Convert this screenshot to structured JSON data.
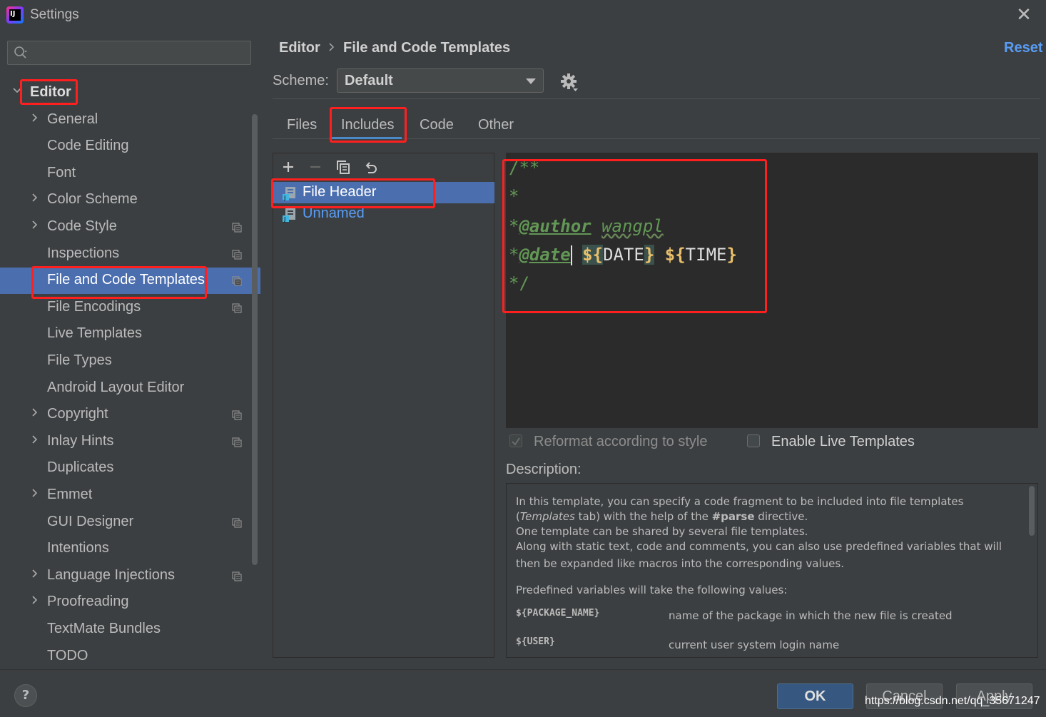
{
  "window": {
    "title": "Settings"
  },
  "search": {
    "placeholder": ""
  },
  "sidebar": {
    "root": "Editor",
    "items": [
      {
        "label": "General",
        "expandable": true,
        "config": false
      },
      {
        "label": "Code Editing",
        "expandable": false,
        "config": false
      },
      {
        "label": "Font",
        "expandable": false,
        "config": false
      },
      {
        "label": "Color Scheme",
        "expandable": true,
        "config": false
      },
      {
        "label": "Code Style",
        "expandable": true,
        "config": true
      },
      {
        "label": "Inspections",
        "expandable": false,
        "config": true
      },
      {
        "label": "File and Code Templates",
        "expandable": false,
        "config": true,
        "selected": true
      },
      {
        "label": "File Encodings",
        "expandable": false,
        "config": true
      },
      {
        "label": "Live Templates",
        "expandable": false,
        "config": false
      },
      {
        "label": "File Types",
        "expandable": false,
        "config": false
      },
      {
        "label": "Android Layout Editor",
        "expandable": false,
        "config": false
      },
      {
        "label": "Copyright",
        "expandable": true,
        "config": true
      },
      {
        "label": "Inlay Hints",
        "expandable": true,
        "config": true
      },
      {
        "label": "Duplicates",
        "expandable": false,
        "config": false
      },
      {
        "label": "Emmet",
        "expandable": true,
        "config": false
      },
      {
        "label": "GUI Designer",
        "expandable": false,
        "config": true
      },
      {
        "label": "Intentions",
        "expandable": false,
        "config": false
      },
      {
        "label": "Language Injections",
        "expandable": true,
        "config": true
      },
      {
        "label": "Proofreading",
        "expandable": true,
        "config": false
      },
      {
        "label": "TextMate Bundles",
        "expandable": false,
        "config": false
      },
      {
        "label": "TODO",
        "expandable": false,
        "config": false
      }
    ]
  },
  "breadcrumb": {
    "parent": "Editor",
    "current": "File and Code Templates"
  },
  "reset_label": "Reset",
  "scheme": {
    "label": "Scheme:",
    "value": "Default"
  },
  "tabs": [
    "Files",
    "Includes",
    "Code",
    "Other"
  ],
  "active_tab": "Includes",
  "templates": [
    {
      "name": "File Header",
      "selected": true
    },
    {
      "name": "Unnamed",
      "selected": false
    }
  ],
  "code": {
    "line1": "/**",
    "line2": "*",
    "line3_star": "*",
    "author_tag": "@author",
    "author_value": "wangpl",
    "line4_star": "*",
    "date_tag": "@date",
    "date_open": "${",
    "date_var": "DATE",
    "date_close": "}",
    "time_open": "${",
    "time_var": "TIME",
    "time_close": "}",
    "line5": "*/"
  },
  "options": {
    "reformat": {
      "label": "Reformat according to style",
      "checked": true,
      "disabled": true
    },
    "live_templates": {
      "label": "Enable Live Templates",
      "checked": false
    }
  },
  "description": {
    "label": "Description:",
    "l1": "In this template, you can specify a code fragment to be included into file templates",
    "l2a": "(",
    "l2b": "Templates",
    "l2c": " tab) with the help of the ",
    "l2d": "#parse",
    "l2e": " directive.",
    "l3": "One template can be shared by several file templates.",
    "l4": "Along with static text, code and comments, you can also use predefined variables that will",
    "l5": "then be expanded like macros into the corresponding values.",
    "l6": "Predefined variables will take the following values:",
    "vars": [
      {
        "name": "${PACKAGE_NAME}",
        "desc": "name of the package in which the new file is created"
      },
      {
        "name": "${USER}",
        "desc": "current user system login name"
      }
    ]
  },
  "footer": {
    "help": "?",
    "ok": "OK",
    "cancel": "Cancel",
    "apply": "Apply"
  },
  "watermark": "https://blog.csdn.net/qq_35671247",
  "colors": {
    "accent": "#4b6eaf",
    "link": "#589df6",
    "highlight_box": "#ff1f1f",
    "comment": "#629755",
    "brace": "#e8bf6a"
  }
}
